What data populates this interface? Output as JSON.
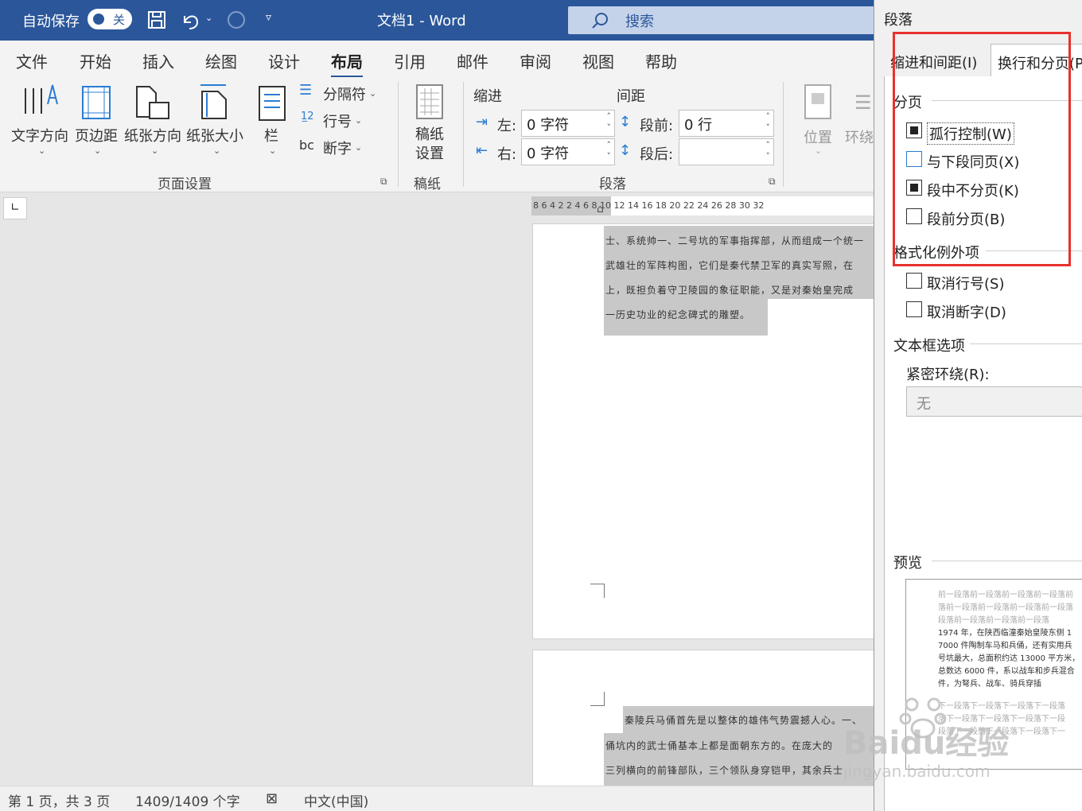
{
  "titlebar": {
    "autosave_label": "自动保存",
    "autosave_state": "关",
    "doc_title": "文档1  -  Word",
    "search_placeholder": "搜索"
  },
  "menu": [
    "文件",
    "开始",
    "插入",
    "绘图",
    "设计",
    "布局",
    "引用",
    "邮件",
    "审阅",
    "视图",
    "帮助"
  ],
  "active_menu": "布局",
  "ribbon": {
    "text_direction": "文字方向",
    "margins": "页边距",
    "orientation": "纸张方向",
    "size": "纸张大小",
    "columns": "栏",
    "breaks": "分隔符",
    "line_numbers": "行号",
    "hyphenation": "断字",
    "page_setup_group": "页面设置",
    "draft_paper_line1": "稿纸",
    "draft_paper_line2": "设置",
    "draft_group": "稿纸",
    "indent_label": "缩进",
    "spacing_label": "间距",
    "left_label": "左:",
    "right_label": "右:",
    "left_value": "0 字符",
    "right_value": "0 字符",
    "before_label": "段前:",
    "after_label": "段后:",
    "before_value": "0 行",
    "after_value": "",
    "paragraph_group": "段落",
    "position": "位置",
    "wrap": "环绕"
  },
  "ruler_numbers": "8   6   4   2        2   4   6   8  10  12  14  16  18  20  22  24  26  28  30  32",
  "page1_lines": [
    "士、系统帅一、二号坑的军事指挥部，从而组成一个统一",
    "武雄壮的军阵构图，它们是秦代禁卫军的真实写照，在",
    "上，既担负着守卫陵园的象征职能，又是对秦始皇完成",
    "一历史功业的纪念碑式的雕塑。"
  ],
  "page2_lines": [
    "秦陵兵马俑首先是以整体的雄伟气势震撼人心。一、",
    "俑坑内的武士俑基本上都是面朝东方的。在庞大的",
    "三列横向的前锋部队，三个领队身穿铠甲，其余兵士"
  ],
  "status": {
    "page": "第 1 页，共 3 页",
    "words": "1409/1409 个字",
    "language": "中文(中国)"
  },
  "dialog": {
    "title": "段落",
    "tab1": "缩进和间距(I)",
    "tab2": "换行和分页(P)",
    "pagination_label": "分页",
    "widow_control": "孤行控制(W)",
    "keep_with_next": "与下段同页(X)",
    "keep_lines": "段中不分页(K)",
    "page_break_before": "段前分页(B)",
    "formatting_exceptions": "格式化例外项",
    "suppress_line_numbers": "取消行号(S)",
    "dont_hyphenate": "取消断字(D)",
    "textbox_options": "文本框选项",
    "tight_wrap": "紧密环绕(R):",
    "tight_wrap_value": "无",
    "preview_label": "预览",
    "preview_prev1": "前一段落前一段落前一段落前一段落前",
    "preview_prev2": "落前一段落前一段落前一段落前一段落",
    "preview_prev3": "段落前一段落前一段落前一段落",
    "preview_body1": "1974 年，在陕西临潼秦始皇陵东侧 1",
    "preview_body2": "7000 件陶制车马和兵俑，还有实用兵",
    "preview_body3": "号坑最大，总面积约达 13000 平方米，",
    "preview_body4": "总数达 6000 件，系以战车和步兵混合",
    "preview_body5": "件，为弩兵、战车、骑兵穿插",
    "preview_next1": "下一段落下一段落下一段落下一段落",
    "preview_next2": "落下一段落下一段落下一段落下一段",
    "preview_next3": "段落下一段落下一段落下一段落下一",
    "widow_control_state": "indeterminate",
    "keep_with_next_state": "unchecked",
    "keep_lines_state": "indeterminate",
    "page_break_before_state": "unchecked"
  },
  "watermark": {
    "brand": "Baidu经验",
    "url": "jingyan.baidu.com"
  },
  "colors": {
    "title_blue": "#2b579a",
    "highlight_red": "#e8312d"
  }
}
